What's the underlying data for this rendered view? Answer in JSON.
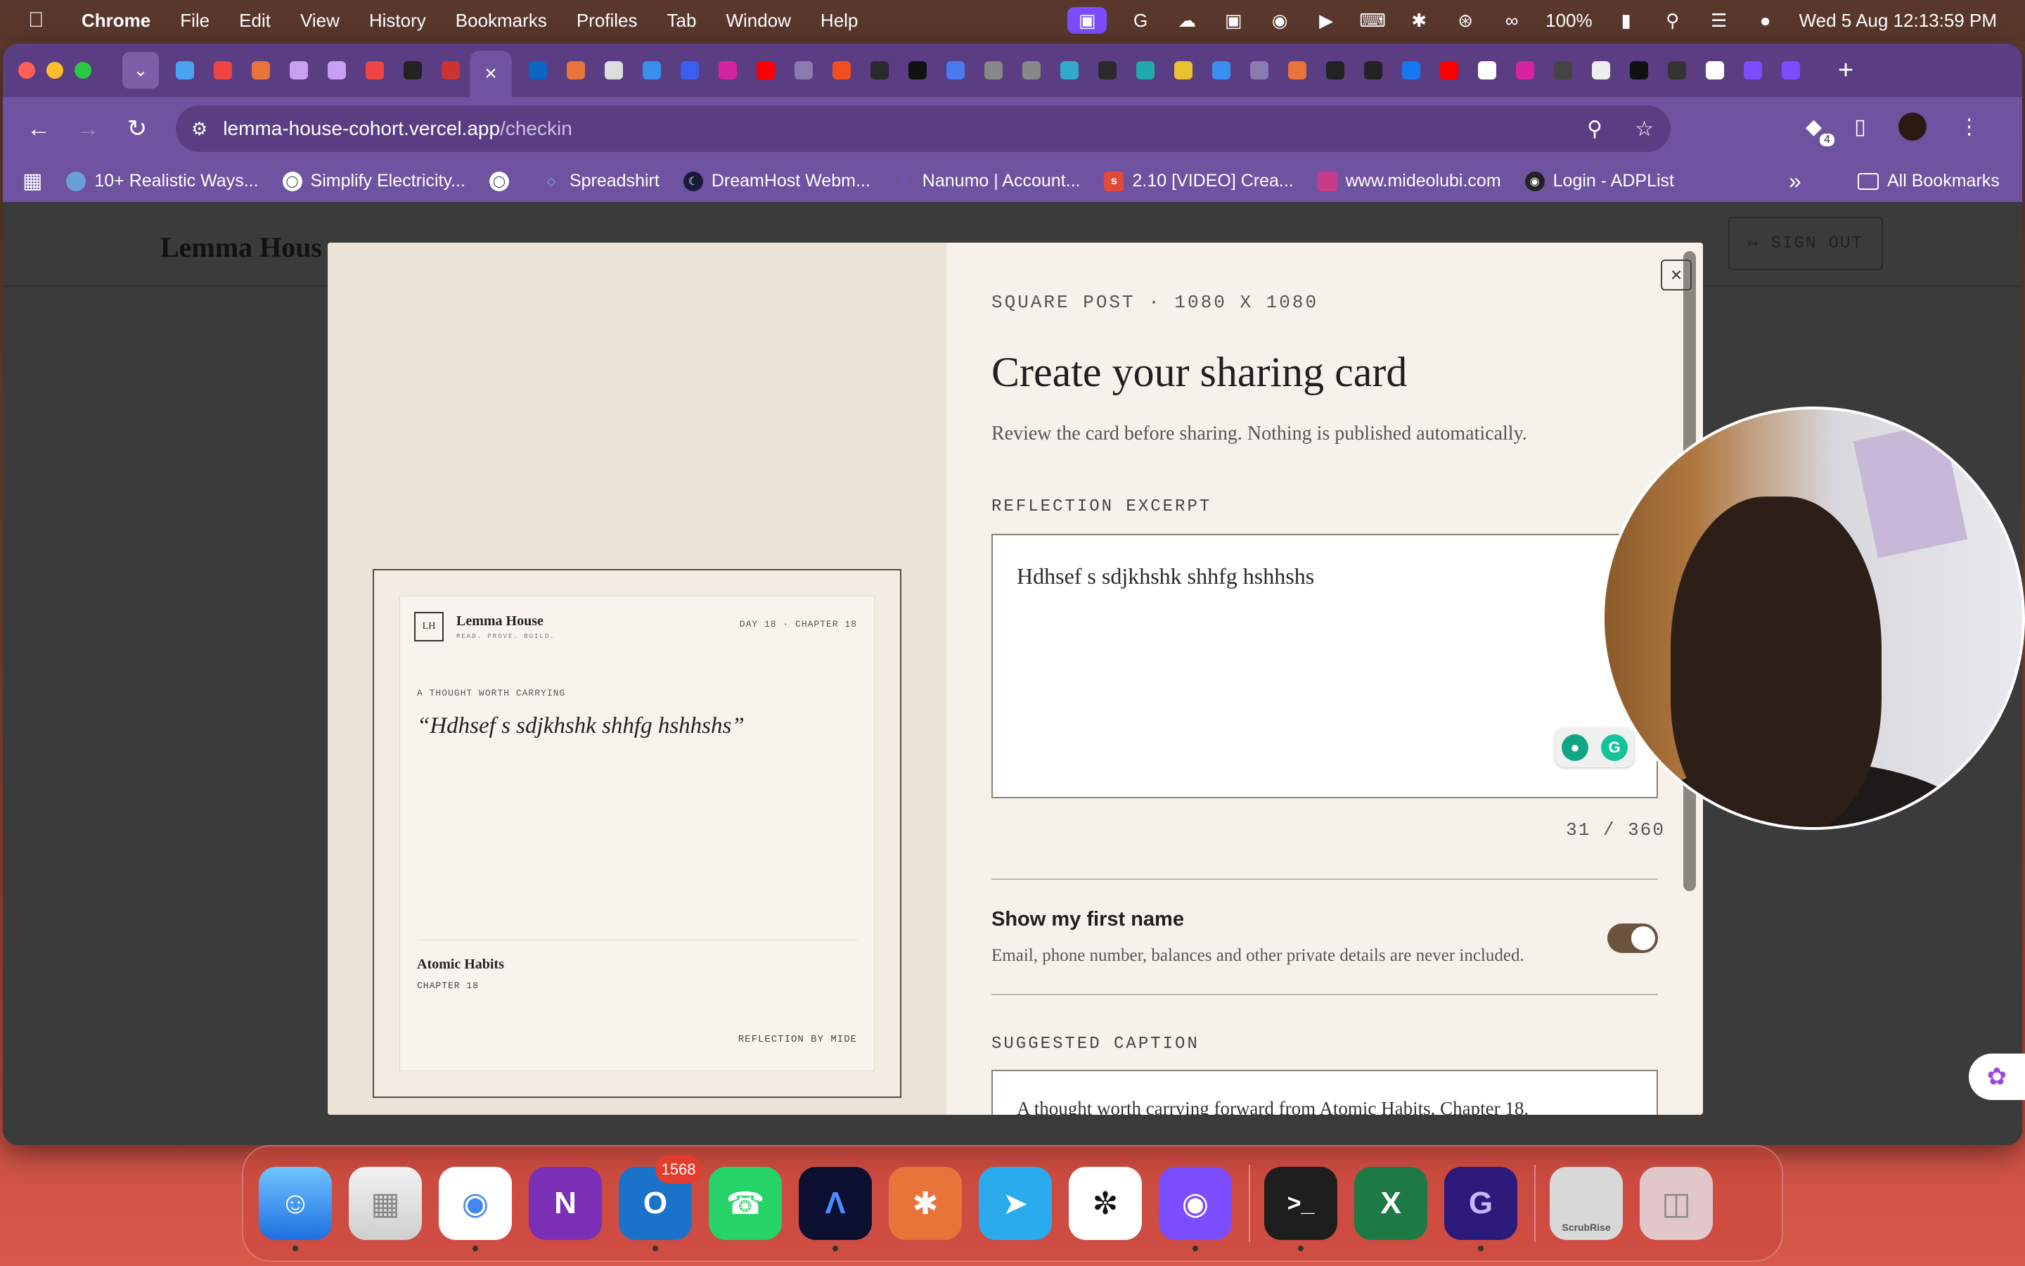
{
  "menubar": {
    "app": "Chrome",
    "items": [
      "File",
      "Edit",
      "View",
      "History",
      "Bookmarks",
      "Profiles",
      "Tab",
      "Window",
      "Help"
    ],
    "battery": "100%",
    "datetime": "Wed 5 Aug  12:13:59 PM"
  },
  "browser": {
    "active_tab_close": "×",
    "tab_icons": [
      "gem",
      "gmail-20",
      "e",
      "lab",
      "lab",
      "gmail",
      "k",
      "red-box",
      "linkedin",
      "asterisk",
      "openai",
      "c",
      "heart",
      "instagram",
      "youtube",
      "dash",
      "figma",
      "zap",
      "a",
      "star",
      "circle",
      "circle",
      "leaf",
      "zap",
      "diamond",
      "s",
      "c",
      "dash",
      "n",
      "c",
      "e",
      "facebook",
      "youtube",
      "google",
      "ig",
      "car",
      "circle",
      "slash",
      "lh",
      "google",
      "g",
      "g"
    ],
    "address_domain": "lemma-house-cohort.vercel.app",
    "address_path": "/checkin",
    "extension_badge": "4",
    "bookmarks": [
      "10+ Realistic Ways...",
      "Simplify Electricity...",
      "",
      "Spreadshirt",
      "DreamHost Webm...",
      "Nanumo | Account...",
      "2.10 [VIDEO] Crea...",
      "www.mideolubi.com",
      "Login - ADPList"
    ],
    "bookmarks_overflow": "»",
    "all_bookmarks": "All Bookmarks"
  },
  "page": {
    "brand": "Lemma Hous",
    "sign_out": "SIGN OUT"
  },
  "modal": {
    "eyebrow": "SQUARE POST · 1080 X 1080",
    "title": "Create your sharing card",
    "description": "Review the card before sharing. Nothing is published automatically.",
    "excerpt_label": "REFLECTION EXCERPT",
    "excerpt_value": "Hdhsef s sdjkhshk shhfg hshhshs",
    "char_count": "31 / 360",
    "toggle_title": "Show my first name",
    "toggle_desc": "Email, phone number, balances and other private details are never included.",
    "toggle_on": true,
    "caption_label": "SUGGESTED CAPTION",
    "caption_value": "A thought worth carrying forward from Atomic Habits, Chapter 18.",
    "close": "×"
  },
  "card": {
    "logo": "LH",
    "brand": "Lemma House",
    "tagline": "READ. PROVE. BUILD.",
    "day_chapter": "DAY 18 · CHAPTER 18",
    "kicker": "A THOUGHT WORTH CARRYING",
    "quote": "“Hdhsef s sdjkhshk shhfg hshhshs”",
    "book": "Atomic Habits",
    "chapter": "CHAPTER 18",
    "byline": "REFLECTION BY MIDE"
  },
  "dock": {
    "apps": [
      "Finder",
      "Launchpad",
      "Chrome",
      "OneNote",
      "Outlook",
      "WhatsApp",
      "Arc",
      "Claude",
      "Telegram",
      "ChatGPT",
      "GitHub Desktop",
      "Terminal",
      "Excel",
      "Grammarly",
      "ScrubRise",
      "Trash"
    ],
    "outlook_badge": "1568",
    "scrubrise_label": "ScrubRise"
  },
  "colors": {
    "tab_strip": "#5a3d82",
    "toolbar": "#6f52a0",
    "modal_bg": "#f6f2eb",
    "toggle": "#6b533d"
  }
}
